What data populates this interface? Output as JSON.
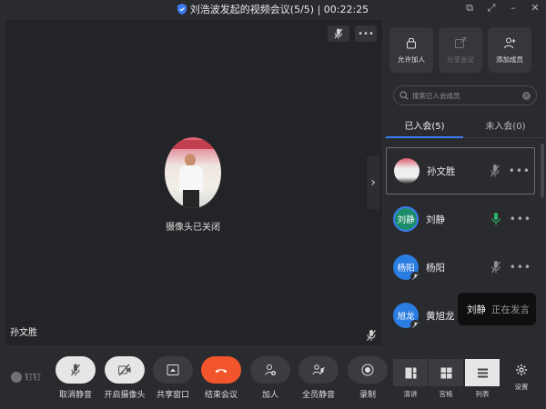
{
  "window": {
    "title": "刘浩波发起的视频会议(5/5) | 00:22:25"
  },
  "stage": {
    "camera_off_text": "摄像头已关闭",
    "speaker_name": "孙文胜"
  },
  "panel": {
    "actions": [
      {
        "label": "允许加人",
        "icon": "lock-icon",
        "enabled": true
      },
      {
        "label": "分享会议",
        "icon": "share-icon",
        "enabled": false
      },
      {
        "label": "添加成员",
        "icon": "add-user-icon",
        "enabled": true
      }
    ],
    "search": {
      "placeholder": "搜索已入会成员"
    },
    "tabs": [
      {
        "label": "已入会(5)",
        "active": true
      },
      {
        "label": "未入会(0)",
        "active": false
      }
    ],
    "members": [
      {
        "name": "孙文胜",
        "avatar_text": "",
        "avatar_type": "photo",
        "mic": "muted",
        "selected": true
      },
      {
        "name": "刘静",
        "avatar_text": "刘静",
        "avatar_type": "green",
        "mic": "speaking",
        "selected": false
      },
      {
        "name": "杨阳",
        "avatar_text": "杨阳",
        "avatar_type": "blue",
        "mic": "muted",
        "selected": false
      },
      {
        "name": "黄旭龙",
        "avatar_text": "旭龙",
        "avatar_type": "blue",
        "mic": "muted",
        "selected": false
      }
    ]
  },
  "toast": {
    "speaker": "刘静",
    "status": "正在发言"
  },
  "bottombar": {
    "brand": "钉钉",
    "controls": [
      {
        "label": "取消静音",
        "icon": "mic-off-icon",
        "style": "light"
      },
      {
        "label": "开启摄像头",
        "icon": "camera-off-icon",
        "style": "light"
      },
      {
        "label": "共享窗口",
        "icon": "share-screen-icon",
        "style": "dark"
      },
      {
        "label": "结束会议",
        "icon": "hangup-icon",
        "style": "red"
      },
      {
        "label": "加人",
        "icon": "add-person-icon",
        "style": "dark"
      },
      {
        "label": "全员静音",
        "icon": "mute-all-icon",
        "style": "dark"
      },
      {
        "label": "录制",
        "icon": "record-icon",
        "style": "dark"
      }
    ],
    "views": [
      {
        "label": "演讲",
        "icon": "speaker-view-icon",
        "active": false
      },
      {
        "label": "宫格",
        "icon": "grid-view-icon",
        "active": false
      },
      {
        "label": "列表",
        "icon": "list-view-icon",
        "active": true
      }
    ],
    "settings_label": "设置"
  },
  "colors": {
    "accent": "#3b7cf0",
    "end_call": "#f2552c",
    "speaking_mic": "#2fb36b",
    "avatar_green": "#1c8d6a",
    "avatar_blue": "#2a7de1"
  }
}
